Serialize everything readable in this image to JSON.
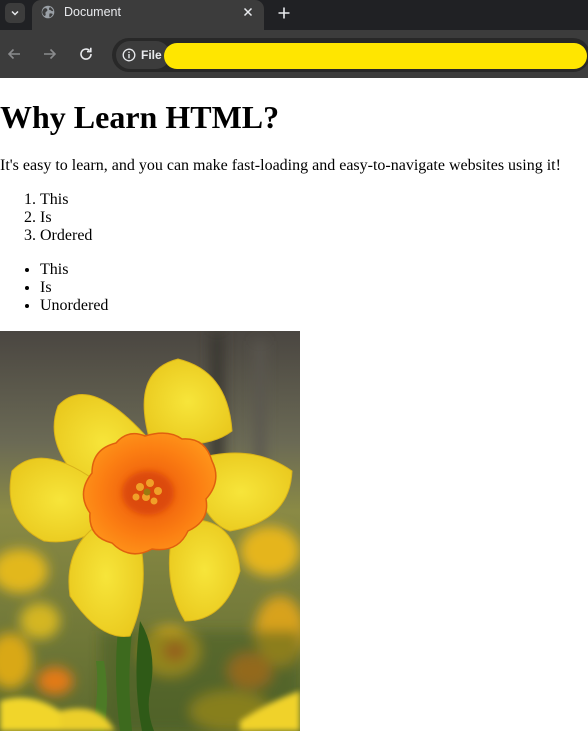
{
  "browser": {
    "tab": {
      "title": "Document",
      "favicon": "globe-icon"
    },
    "toolbar": {
      "back_icon": "arrow-left-icon",
      "forward_icon": "arrow-right-icon",
      "reload_icon": "reload-icon",
      "site_info_label": "File",
      "site_info_icon": "info-icon",
      "url_redaction_color": "#ffe600"
    }
  },
  "page": {
    "heading": "Why Learn HTML?",
    "intro": "It's easy to learn, and you can make fast-loading and easy-to-navigate websites using it!",
    "ordered_list": [
      "This",
      "Is",
      "Ordered"
    ],
    "unordered_list": [
      "This",
      "Is",
      "Unordered"
    ],
    "image": {
      "subject": "yellow daffodil with orange trumpet"
    }
  }
}
